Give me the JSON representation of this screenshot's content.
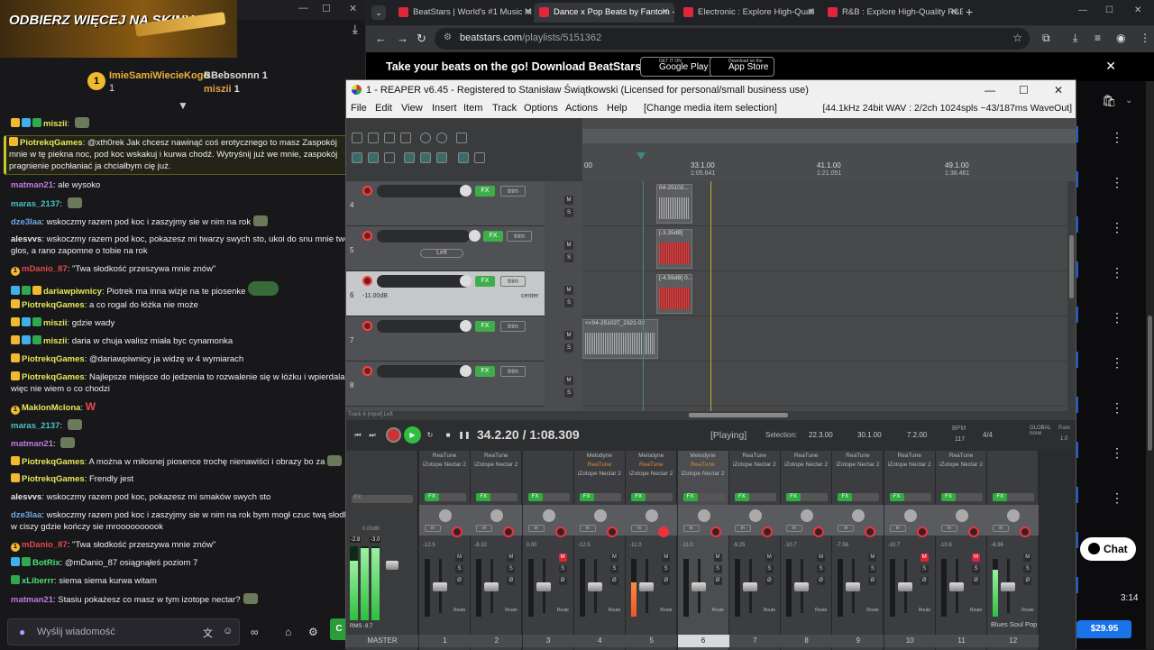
{
  "chat": {
    "promo_text": "ODBIERZ WIĘCEJ NA SKINY",
    "leader": {
      "rank": "1",
      "name": "ImieSamiWiecieKogo",
      "count": "1"
    },
    "lb2": [
      {
        "name": "BBebsonnn",
        "count": "1"
      },
      {
        "name": "miszii",
        "count": "1"
      }
    ],
    "messages": [
      {
        "user": "miszii",
        "color": "#e8e85a",
        "text": ""
      },
      {
        "user": "PiotrekqGames",
        "color": "#e8e85a",
        "text": "@xth0rek Jak chcesz nawinąć coś erotycznego to masz Zaspokój mnie w tę piekna noc, pod koc wskakuj i kurwa chodź. Wytryśnij już we mnie, zaspokój pragnienie pochłaniać ja chciałbym cię już."
      },
      {
        "user": "matman21",
        "color": "#c07ae0",
        "text": "ale wysoko"
      },
      {
        "user": "maras_2137",
        "color": "#4ac0c0",
        "text": ""
      },
      {
        "user": "dze3laa",
        "color": "#6fa8e8",
        "text": "wskoczmy razem pod koc i zaszyjmy sie w nim na rok"
      },
      {
        "user": "alesvvs",
        "color": "#e8e8e8",
        "text": "wskoczmy razem pod koc, pokazesz mi twarzy swych sto, ukoi do snu mnie twoj glos, a rano zapomne o tobie na rok"
      },
      {
        "user": "mDanio_87",
        "color": "#e04a4a",
        "text": "\"Twa słodkość przeszywa mnie znów\""
      },
      {
        "user": "dariawpiwnicy",
        "color": "#e8e85a",
        "text": "Piotrek ma inna wizje na te piosenke"
      },
      {
        "user": "PiotrekqGames",
        "color": "#e8e85a",
        "text": "a co rogal do łóżka nie może"
      },
      {
        "user": "miszii",
        "color": "#e8e85a",
        "text": "gdzie wady"
      },
      {
        "user": "miszii",
        "color": "#e8e85a",
        "text": "daria w chuja walisz miała byc cynamonka"
      },
      {
        "user": "PiotrekqGames",
        "color": "#e8e85a",
        "text": "@dariawpiwnicy ja widzę w 4 wymiarach"
      },
      {
        "user": "PiotrekqGames",
        "color": "#e8e85a",
        "text": "Najlepsze miejsce do jedzenia to rozwalenie się w łóżku i wpierdalanie więc nie wiem o co chodzi"
      },
      {
        "user": "MaklonMclona",
        "color": "#e8e85a",
        "text": "W"
      },
      {
        "user": "maras_2137",
        "color": "#4ac0c0",
        "text": ""
      },
      {
        "user": "matman21",
        "color": "#c07ae0",
        "text": ""
      },
      {
        "user": "PiotrekqGames",
        "color": "#e8e85a",
        "text": "A można w miłosnej piosence trochę nienawiści i obrazy bo za"
      },
      {
        "user": "PiotrekqGames",
        "color": "#e8e85a",
        "text": "Frendly jest"
      },
      {
        "user": "alesvvs",
        "color": "#e8e8e8",
        "text": "wskoczmy razem pod koc, pokazesz mi smaków swych sto"
      },
      {
        "user": "dze3laa",
        "color": "#6fa8e8",
        "text": "wskoczmy razem pod koc i zaszyjmy sie w nim na rok bym mogł czuc twą słodkość w ciszy gdzie kończy sie mroooooooook"
      },
      {
        "user": "mDanio_87",
        "color": "#e04a4a",
        "text": "\"Twa słodkość przeszywa mnie znów\""
      },
      {
        "user": "BotRix",
        "color": "#4ae07a",
        "text": "@mDanio_87 osiągnąłeś poziom 7"
      },
      {
        "user": "xLiberrr",
        "color": "#4ae07a",
        "text": "siema siema kurwa witam"
      },
      {
        "user": "matman21",
        "color": "#c07ae0",
        "text": "Stasiu pokażesz co masz w tym izotope nectar?"
      }
    ],
    "input_placeholder": "Wyślij wiadomość",
    "send_label": "C"
  },
  "browser": {
    "tabs": [
      {
        "title": "BeatStars | World's #1 Music M",
        "active": false
      },
      {
        "title": "Dance x Pop Beats by Fantom -",
        "active": true
      },
      {
        "title": "Electronic : Explore High-Quali",
        "active": false
      },
      {
        "title": "R&B : Explore High-Quality R&E",
        "active": false
      }
    ],
    "url_host": "beatstars.com",
    "url_path": "/playlists/5151362",
    "banner_text": "Take your beats on the go! Download BeatStars App",
    "google_play_top": "GET IT ON",
    "google_play": "Google Play",
    "app_store_top": "Download on the",
    "app_store": "App Store",
    "chat_button": "Chat",
    "time": "3:14",
    "price": "$29.95"
  },
  "reaper": {
    "title": "1 - REAPER v6.45 - Registered to Stanisław Świątkowski (Licensed for personal/small business use)",
    "menu": [
      "File",
      "Edit",
      "View",
      "Insert",
      "Item",
      "Track",
      "Options",
      "Actions",
      "Help",
      "[Change media item selection]"
    ],
    "format": "[44.1kHz 24bit WAV : 2/2ch 1024spls ~43/187ms WaveOut]",
    "ruler": [
      {
        "bar": "00",
        "time": ""
      },
      {
        "bar": "33.1.00",
        "time": "1:05.641"
      },
      {
        "bar": "41.1.00",
        "time": "1:21.051"
      },
      {
        "bar": "49.1.00",
        "time": "1:38.461"
      }
    ],
    "tracks": [
      {
        "num": "4",
        "info": ""
      },
      {
        "num": "5",
        "info": "Left"
      },
      {
        "num": "6",
        "info": "-11.00dB",
        "info2": "center"
      },
      {
        "num": "7",
        "info": ""
      },
      {
        "num": "8",
        "info": ""
      }
    ],
    "items": [
      {
        "label": "04-25102..."
      },
      {
        "label": "[-3.35dB]"
      },
      {
        "label": "[-4.59dB] 0..."
      },
      {
        "label": "<<04-251027_2321-02"
      }
    ],
    "bottom_left_note": "Track 6 [mput] Left",
    "time_display": "34.2.20 / 1:08.309",
    "status": "[Playing]",
    "selection_label": "Selection:",
    "selection": [
      "22.3.00",
      "30.1.00",
      "7.2.00"
    ],
    "bpm_label": "BPM",
    "bpm": "117",
    "timesig": "4/4",
    "global_label": "GLOBAL",
    "global_value": "none",
    "rate_label": "Rate:",
    "rate_value": "1.0",
    "master": {
      "label": "MASTER",
      "db": "0.00dB",
      "peak_l": "-2.8",
      "peak_r": "-3.0",
      "rms": "RMS -9.7"
    },
    "strips": [
      {
        "num": "1",
        "fx1": "ReaTune",
        "fx2": "iZotope Nectar 2",
        "fx3": "",
        "vol": "-12.5",
        "recon": false,
        "m_red": false
      },
      {
        "num": "2",
        "fx1": "ReaTune",
        "fx2": "iZotope Nectar 2",
        "fx3": "",
        "vol": "-8.32",
        "recon": false,
        "m_red": false
      },
      {
        "num": "3",
        "fx1": "",
        "fx2": "",
        "fx3": "",
        "vol": "0.00",
        "recon": false,
        "m_red": true
      },
      {
        "num": "4",
        "fx1": "Melodyne",
        "fx2": "ReaTune",
        "fx3": "iZotope Nectar 2",
        "vol": "-12.5",
        "recon": false,
        "m_red": false
      },
      {
        "num": "5",
        "fx1": "Melodyne",
        "fx2": "ReaTune",
        "fx3": "iZotope Nectar 2",
        "vol": "-11.0",
        "recon": true,
        "m_red": false
      },
      {
        "num": "6",
        "fx1": "Melodyne",
        "fx2": "ReaTune",
        "fx3": "iZotope Nectar 2",
        "vol": "-11.0",
        "recon": false,
        "m_red": false
      },
      {
        "num": "7",
        "fx1": "ReaTune",
        "fx2": "iZotope Nectar 2",
        "fx3": "",
        "vol": "-9.25",
        "recon": false,
        "m_red": false
      },
      {
        "num": "8",
        "fx1": "ReaTune",
        "fx2": "iZotope Nectar 2",
        "fx3": "",
        "vol": "-10.7",
        "recon": false,
        "m_red": false
      },
      {
        "num": "9",
        "fx1": "ReaTune",
        "fx2": "iZotope Nectar 2",
        "fx3": "",
        "vol": "-7.56",
        "recon": false,
        "m_red": false
      },
      {
        "num": "10",
        "fx1": "ReaTune",
        "fx2": "iZotope Nectar 2",
        "fx3": "",
        "vol": "-10.7",
        "recon": false,
        "m_red": true
      },
      {
        "num": "11",
        "fx1": "ReaTune",
        "fx2": "iZotope Nectar 2",
        "fx3": "",
        "vol": "-10.6",
        "recon": false,
        "m_red": true
      },
      {
        "num": "12",
        "fx1": "",
        "fx2": "",
        "fx3": "",
        "vol": "-6.96",
        "recon": false,
        "m_red": false
      }
    ],
    "strip12_name": "Blues Soul Pop"
  }
}
